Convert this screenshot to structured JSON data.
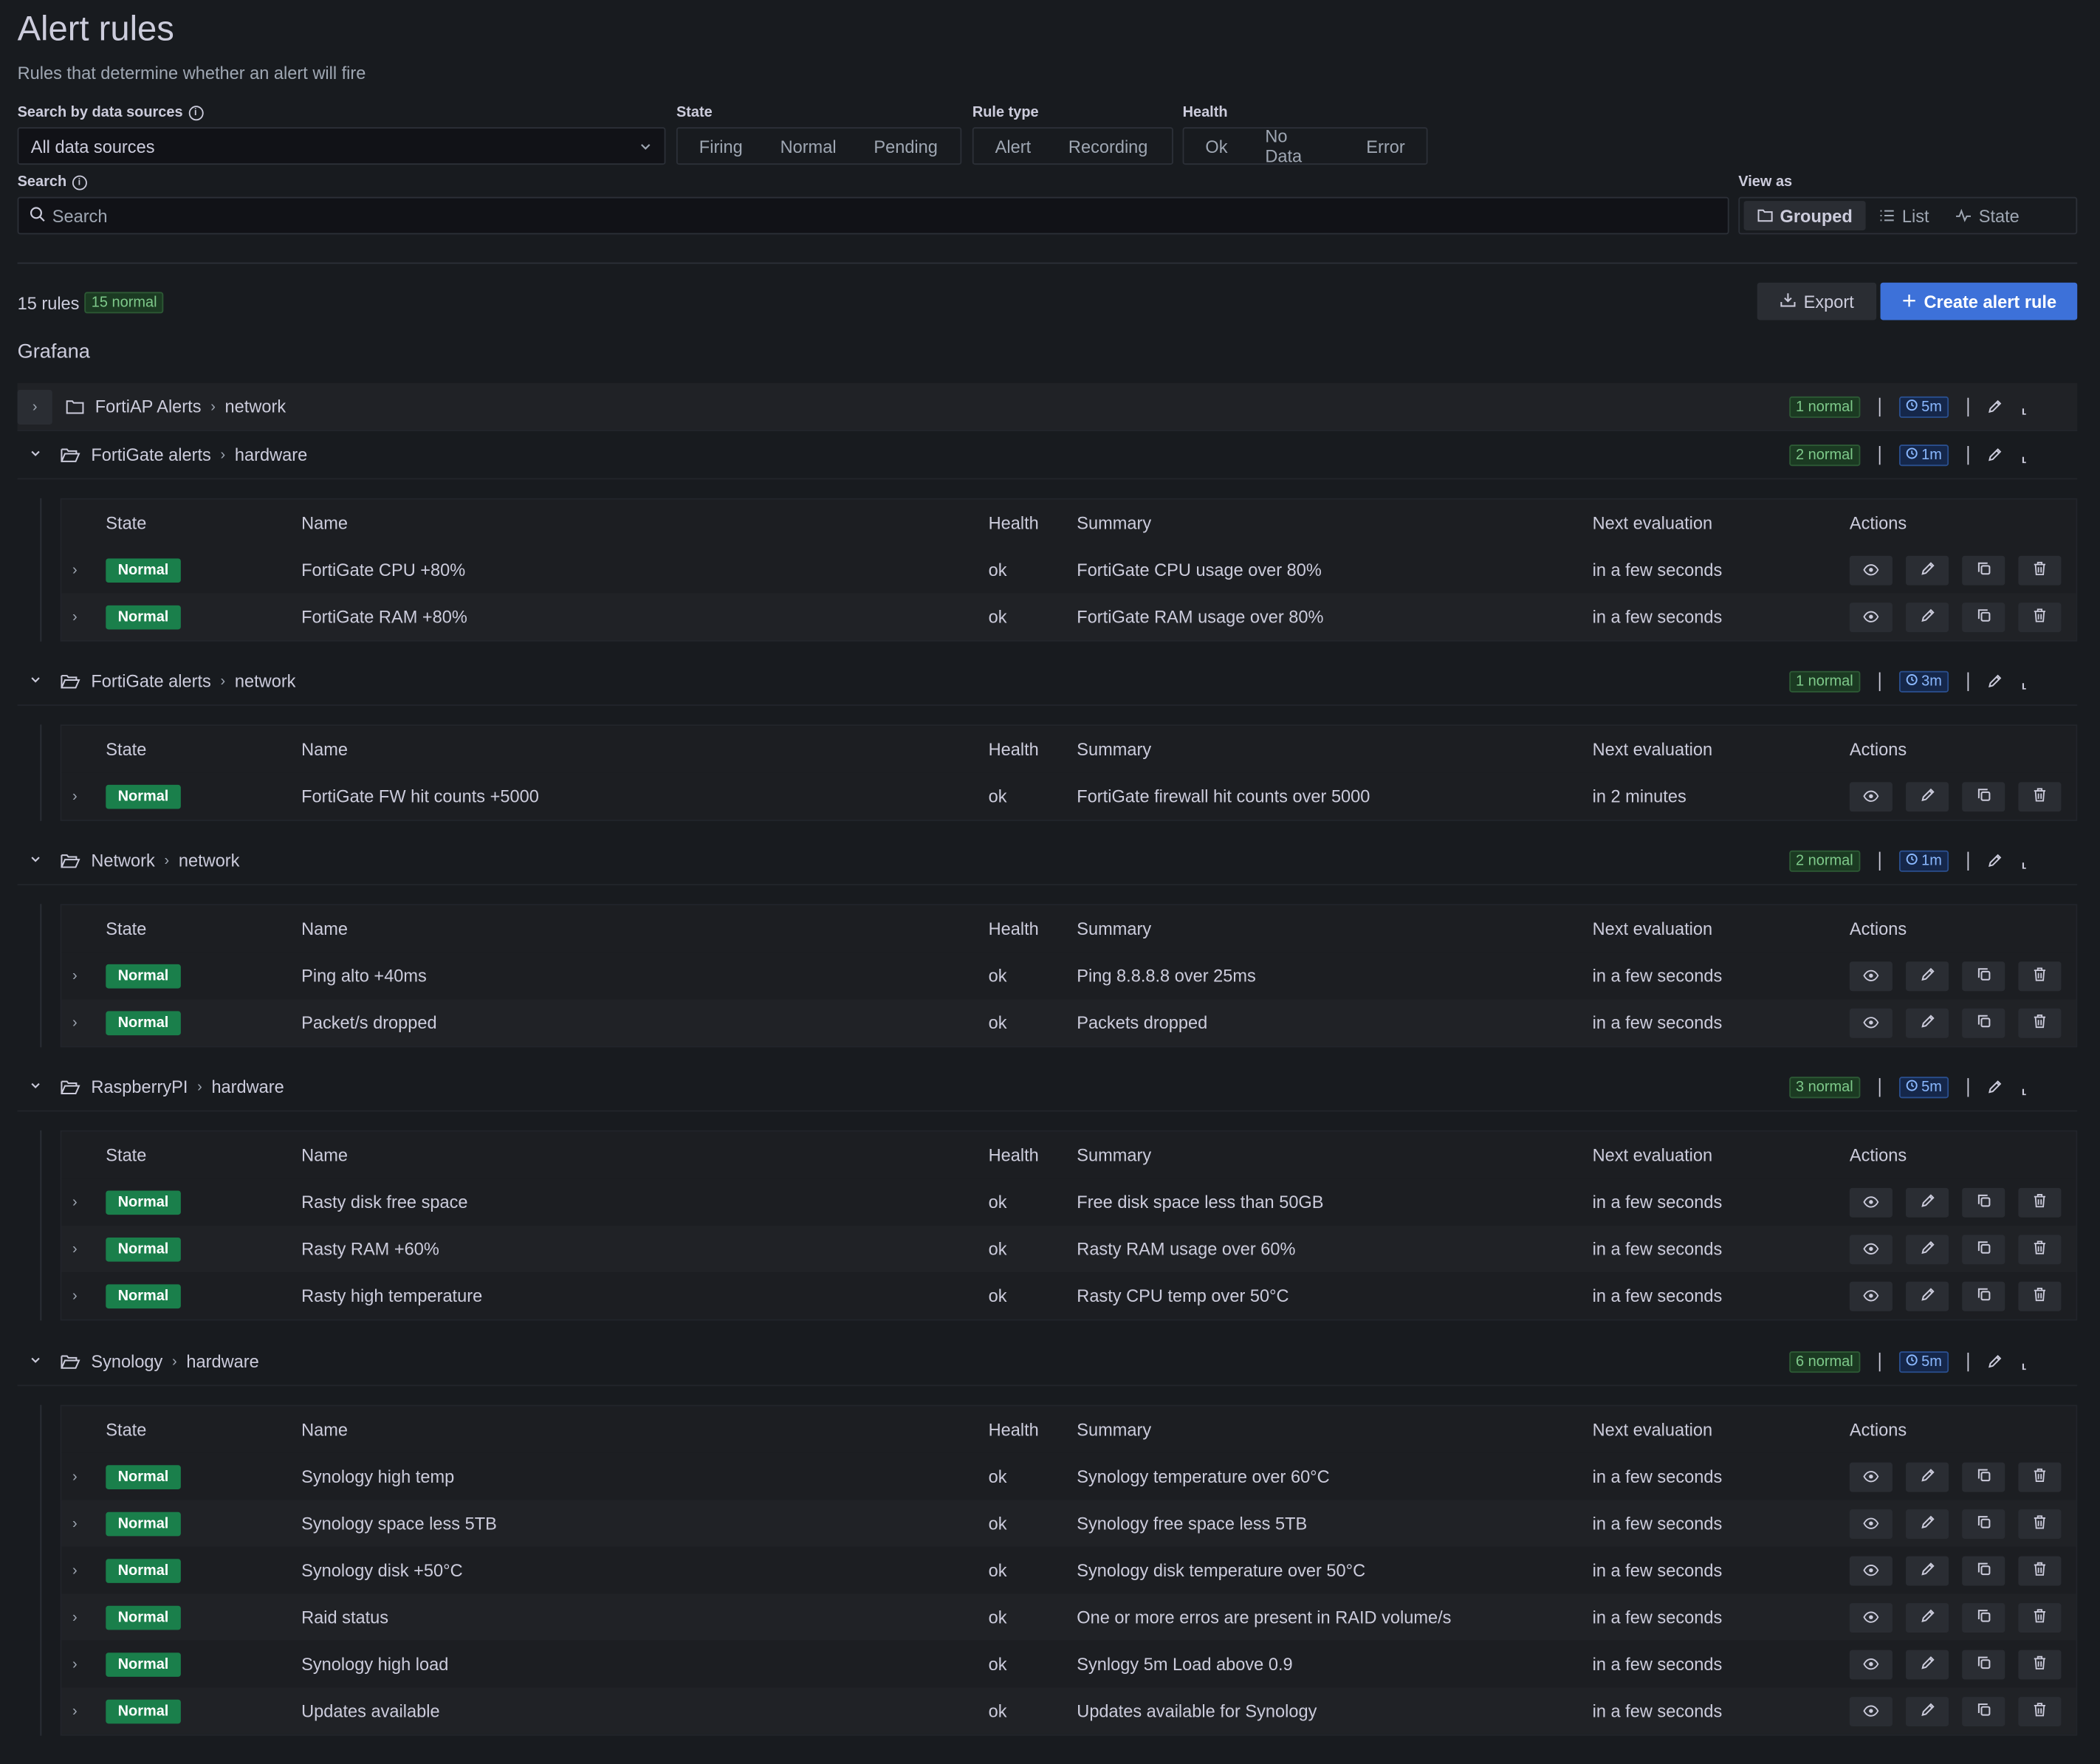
{
  "header": {
    "title": "Alert rules",
    "subtitle": "Rules that determine whether an alert will fire"
  },
  "filters": {
    "datasource_label": "Search by data sources",
    "datasource_value": "All data sources",
    "state_label": "State",
    "state_options": [
      "Firing",
      "Normal",
      "Pending"
    ],
    "ruletype_label": "Rule type",
    "ruletype_options": [
      "Alert",
      "Recording"
    ],
    "health_label": "Health",
    "health_options": [
      "Ok",
      "No Data",
      "Error"
    ],
    "search_label": "Search",
    "search_placeholder": "Search",
    "viewas_label": "View as",
    "viewas_options": [
      "Grouped",
      "List",
      "State"
    ]
  },
  "summary": {
    "count": "15 rules",
    "badge": "15 normal"
  },
  "toolbar": {
    "export_label": "Export",
    "create_label": "Create alert rule"
  },
  "source_title": "Grafana",
  "columns": [
    "State",
    "Name",
    "Health",
    "Summary",
    "Next evaluation",
    "Actions"
  ],
  "groups": [
    {
      "folder": "FortiAP Alerts",
      "group": "network",
      "badge": "1 normal",
      "interval": "5m",
      "collapsed": true,
      "rules": []
    },
    {
      "folder": "FortiGate alerts",
      "group": "hardware",
      "badge": "2 normal",
      "interval": "1m",
      "rules": [
        {
          "state": "Normal",
          "name": "FortiGate CPU +80%",
          "health": "ok",
          "summary": "FortiGate CPU usage over 80%",
          "next": "in a few seconds"
        },
        {
          "state": "Normal",
          "name": "FortiGate RAM +80%",
          "health": "ok",
          "summary": "FortiGate RAM usage over 80%",
          "next": "in a few seconds"
        }
      ]
    },
    {
      "folder": "FortiGate alerts",
      "group": "network",
      "badge": "1 normal",
      "interval": "3m",
      "rules": [
        {
          "state": "Normal",
          "name": "FortiGate FW hit counts +5000",
          "health": "ok",
          "summary": "FortiGate firewall hit counts over 5000",
          "next": "in 2 minutes"
        }
      ]
    },
    {
      "folder": "Network",
      "group": "network",
      "badge": "2 normal",
      "interval": "1m",
      "rules": [
        {
          "state": "Normal",
          "name": "Ping alto +40ms",
          "health": "ok",
          "summary": "Ping 8.8.8.8 over 25ms",
          "next": "in a few seconds"
        },
        {
          "state": "Normal",
          "name": "Packet/s dropped",
          "health": "ok",
          "summary": "Packets dropped",
          "next": "in a few seconds"
        }
      ]
    },
    {
      "folder": "RaspberryPI",
      "group": "hardware",
      "badge": "3 normal",
      "interval": "5m",
      "rules": [
        {
          "state": "Normal",
          "name": "Rasty disk free space",
          "health": "ok",
          "summary": "Free disk space less than 50GB",
          "next": "in a few seconds"
        },
        {
          "state": "Normal",
          "name": "Rasty RAM +60%",
          "health": "ok",
          "summary": "Rasty RAM usage over 60%",
          "next": "in a few seconds"
        },
        {
          "state": "Normal",
          "name": "Rasty high temperature",
          "health": "ok",
          "summary": "Rasty CPU temp over 50°C",
          "next": "in a few seconds"
        }
      ]
    },
    {
      "folder": "Synology",
      "group": "hardware",
      "badge": "6 normal",
      "interval": "5m",
      "rules": [
        {
          "state": "Normal",
          "name": "Synology high temp",
          "health": "ok",
          "summary": "Synology temperature over 60°C",
          "next": "in a few seconds"
        },
        {
          "state": "Normal",
          "name": "Synology space less 5TB",
          "health": "ok",
          "summary": "Synology free space less 5TB",
          "next": "in a few seconds"
        },
        {
          "state": "Normal",
          "name": "Synology disk +50°C",
          "health": "ok",
          "summary": "Synology disk temperature over 50°C",
          "next": "in a few seconds"
        },
        {
          "state": "Normal",
          "name": "Raid status",
          "health": "ok",
          "summary": "One or more erros are present in RAID volume/s",
          "next": "in a few seconds"
        },
        {
          "state": "Normal",
          "name": "Synology high load",
          "health": "ok",
          "summary": "Synlogy 5m Load above 0.9",
          "next": "in a few seconds"
        },
        {
          "state": "Normal",
          "name": "Updates available",
          "health": "ok",
          "summary": "Updates available for Synology",
          "next": "in a few seconds"
        }
      ]
    }
  ],
  "icons": {
    "eye": "eye-icon",
    "edit": "pencil-icon",
    "copy": "copy-icon",
    "delete": "trash-icon"
  }
}
